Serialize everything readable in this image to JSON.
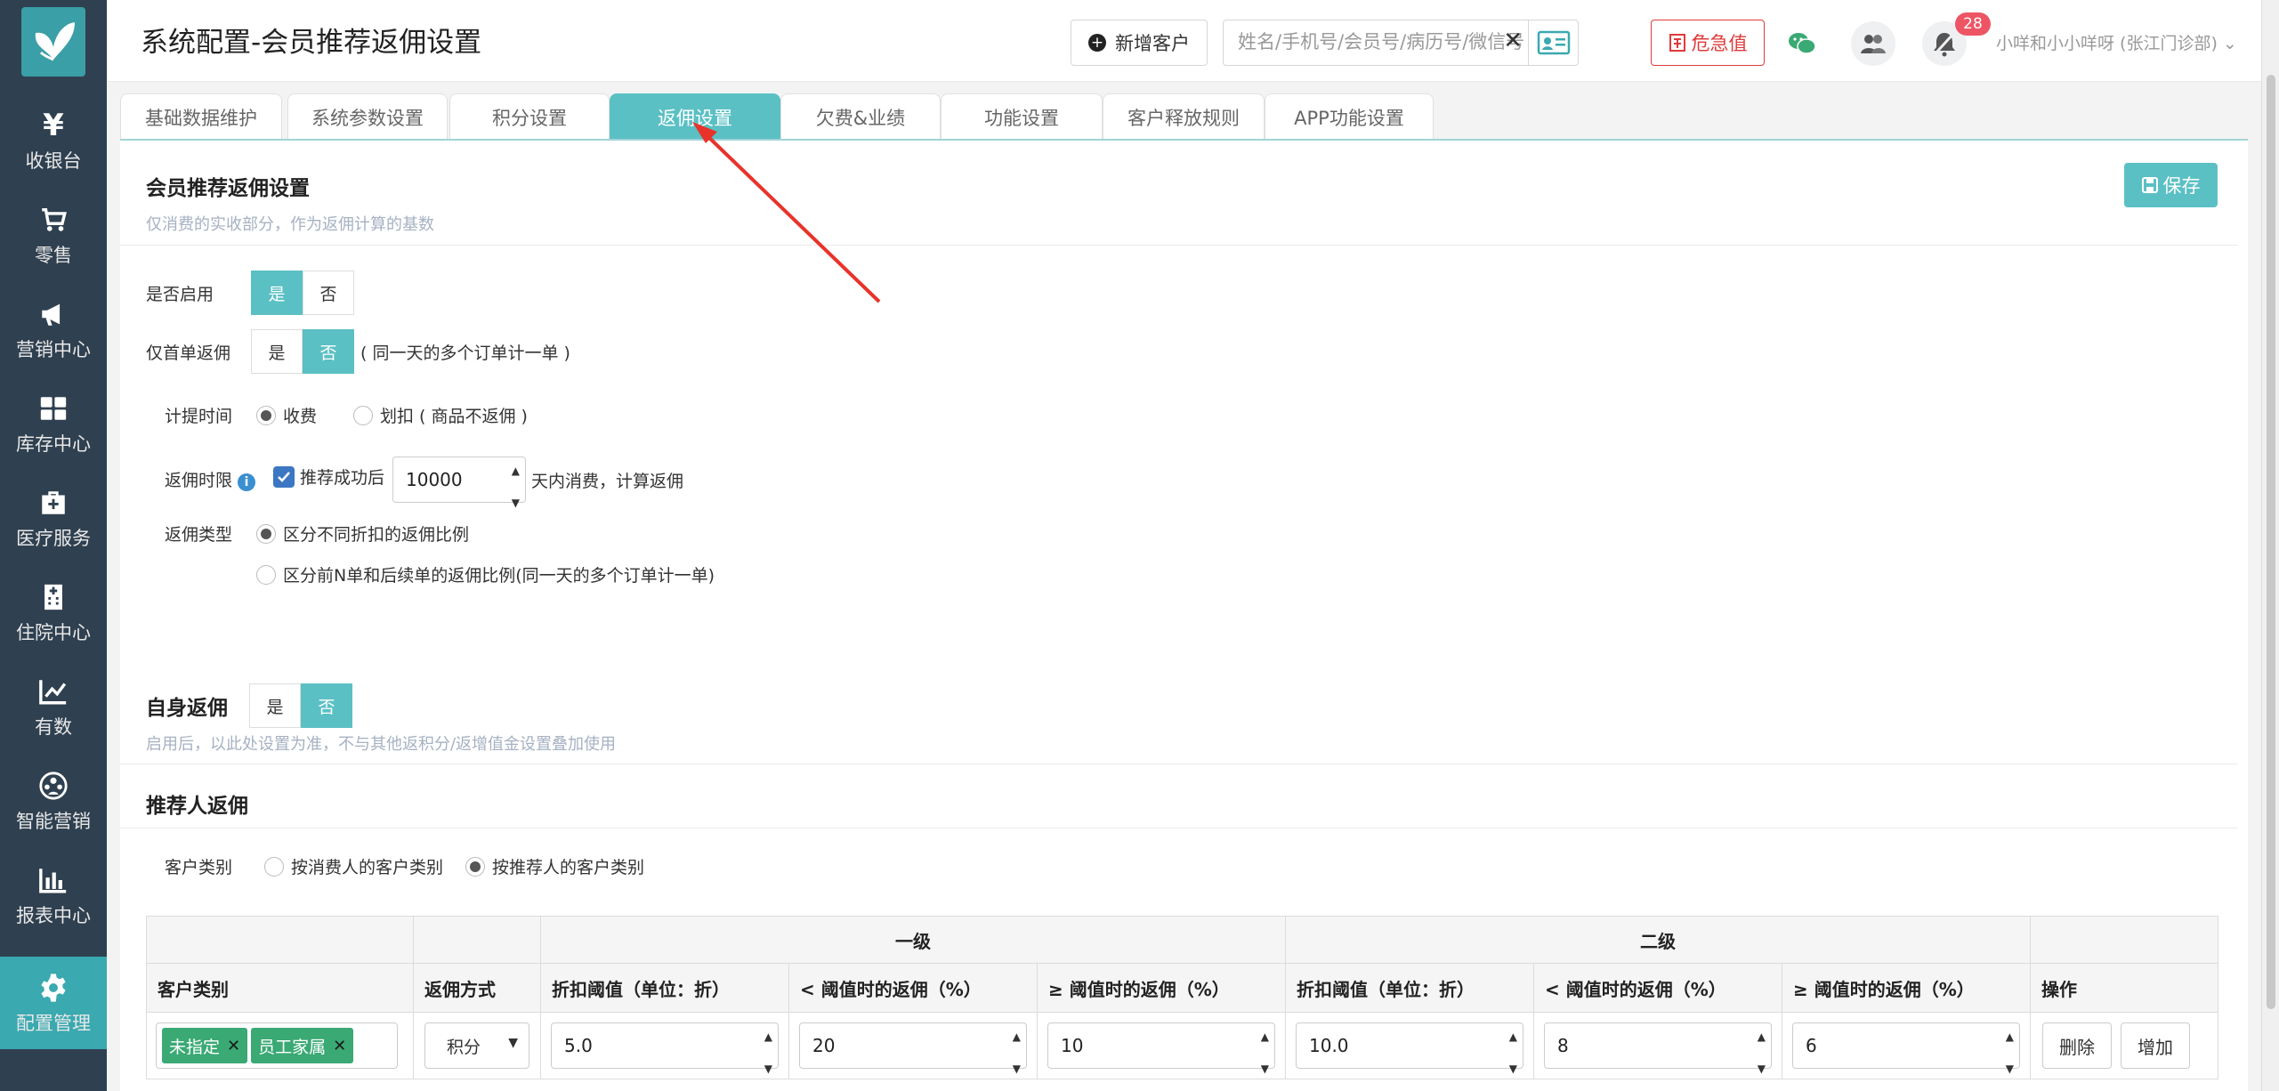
{
  "sidebar": {
    "items": [
      {
        "label": "收银台",
        "icon": "yen-icon"
      },
      {
        "label": "零售",
        "icon": "cart-icon"
      },
      {
        "label": "营销中心",
        "icon": "megaphone-icon"
      },
      {
        "label": "库存中心",
        "icon": "grid-icon"
      },
      {
        "label": "医疗服务",
        "icon": "medkit-icon"
      },
      {
        "label": "住院中心",
        "icon": "hospital-icon"
      },
      {
        "label": "有数",
        "icon": "line-chart-icon"
      },
      {
        "label": "智能营销",
        "icon": "people-icon"
      },
      {
        "label": "报表中心",
        "icon": "bar-chart-icon"
      },
      {
        "label": "配置管理",
        "icon": "gear-icon"
      }
    ],
    "active": "配置管理"
  },
  "header": {
    "title": "系统配置-会员推荐返佣设置",
    "new_customer": "新增客户",
    "search_placeholder": "姓名/手机号/会员号/病历号/微信号",
    "danger_label": "危急值",
    "notification_count": "28",
    "user_name": "小咩和小小咩呀 (张江门诊部)"
  },
  "tabs": [
    "基础数据维护",
    "系统参数设置",
    "积分设置",
    "返佣设置",
    "欠费&业绩",
    "功能设置",
    "客户释放规则",
    "APP功能设置"
  ],
  "active_tab": "返佣设置",
  "settings": {
    "title": "会员推荐返佣设置",
    "subtitle": "仅消费的实收部分，作为返佣计算的基数",
    "save": "保存",
    "enable_label": "是否启用",
    "yes": "是",
    "no": "否",
    "first_order_label": "仅首单返佣",
    "first_order_note": "( 同一天的多个订单计一单 )",
    "accrual_label": "计提时间",
    "accrual_opt1": "收费",
    "accrual_opt2": "划扣 ( 商品不返佣 )",
    "limit_label": "返佣时限",
    "limit_check": "推荐成功后",
    "limit_value": "10000",
    "limit_suffix": "天内消费，计算返佣",
    "type_label": "返佣类型",
    "type_opt1": "区分不同折扣的返佣比例",
    "type_opt2": "区分前N单和后续单的返佣比例(同一天的多个订单计一单)"
  },
  "self_rebate": {
    "title": "自身返佣",
    "subtitle": "启用后，以此处设置为准，不与其他返积分/返增值金设置叠加使用"
  },
  "referrer": {
    "title": "推荐人返佣",
    "category_label": "客户类别",
    "opt1": "按消费人的客户类别",
    "opt2": "按推荐人的客户类别"
  },
  "table": {
    "group1": "一级",
    "group2": "二级",
    "headers": [
      "客户类别",
      "返佣方式",
      "折扣阈值（单位：折）",
      "< 阈值时的返佣（%）",
      "≥ 阈值时的返佣（%）",
      "折扣阈值（单位：折）",
      "< 阈值时的返佣（%）",
      "≥ 阈值时的返佣（%）",
      "操作"
    ],
    "row": {
      "tags": [
        "未指定",
        "员工家属"
      ],
      "method": "积分",
      "l1_threshold": "5.0",
      "l1_below": "20",
      "l1_above": "10",
      "l2_threshold": "10.0",
      "l2_below": "8",
      "l2_above": "6",
      "delete": "删除",
      "add": "增加"
    }
  }
}
